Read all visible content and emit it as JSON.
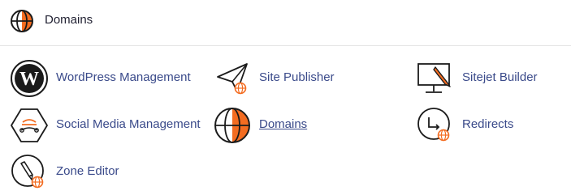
{
  "section": {
    "title": "Domains",
    "icon": "globe-icon"
  },
  "items": [
    {
      "label": "WordPress Management",
      "icon": "wordpress-icon"
    },
    {
      "label": "Site Publisher",
      "icon": "paper-plane-icon"
    },
    {
      "label": "Sitejet Builder",
      "icon": "monitor-pencil-icon"
    },
    {
      "label": "Social Media Management",
      "icon": "social-media-icon"
    },
    {
      "label": "Domains",
      "icon": "globe-icon"
    },
    {
      "label": "Redirects",
      "icon": "redirect-icon"
    },
    {
      "label": "Zone Editor",
      "icon": "zone-editor-icon"
    }
  ],
  "colors": {
    "accent": "#f36c21",
    "link": "#3a4a8a",
    "icon_stroke": "#1b1b1b"
  }
}
